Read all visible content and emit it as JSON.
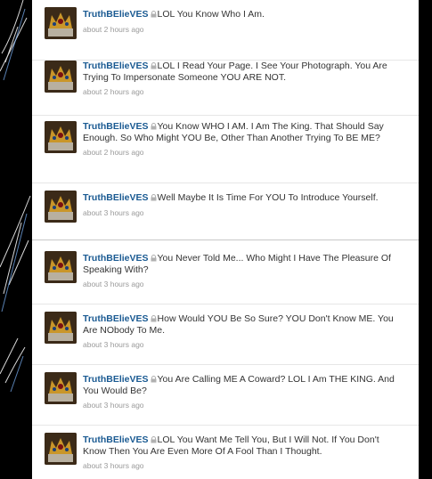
{
  "colors": {
    "username": "#1a5a92",
    "text": "#333333",
    "timestamp": "#9a9a9a",
    "background": "#000000"
  },
  "icons": {
    "avatar": "crown-avatar-icon",
    "protected": "lock-icon"
  },
  "tweets": [
    {
      "user": "TruthBElieVES",
      "text": "LOL You Know Who I Am.",
      "time": "about 2 hours ago"
    },
    {
      "user": "TruthBElieVES",
      "text": "LOL I Read Your Page. I See Your Photograph. You Are Trying To Impersonate Someone YOU ARE NOT.",
      "time": "about 2 hours ago"
    },
    {
      "user": "TruthBElieVES",
      "text": "You Know WHO I AM. I Am The King. That Should Say Enough. So Who Might YOU Be, Other Than Another Trying To BE ME?",
      "time": "about 2 hours ago"
    },
    {
      "user": "TruthBElieVES",
      "text": "Well Maybe It Is Time For YOU To Introduce Yourself.",
      "time": "about 3 hours ago"
    },
    {
      "user": "TruthBElieVES",
      "text": "You Never Told Me... Who Might I Have The Pleasure Of Speaking With?",
      "time": "about 3 hours ago"
    },
    {
      "user": "TruthBElieVES",
      "text": "How Would YOU Be So Sure? YOU Don't Know ME. You Are NObody To Me.",
      "time": "about 3 hours ago"
    },
    {
      "user": "TruthBElieVES",
      "text": "You Are Calling ME A Coward? LOL I Am THE KING. And You Would Be?",
      "time": "about 3 hours ago"
    },
    {
      "user": "TruthBElieVES",
      "text": "LOL You Want Me Tell You, But I Will Not. If You Don't Know Then You Are Even More Of A Fool Than I Thought.",
      "time": "about 3 hours ago"
    }
  ]
}
